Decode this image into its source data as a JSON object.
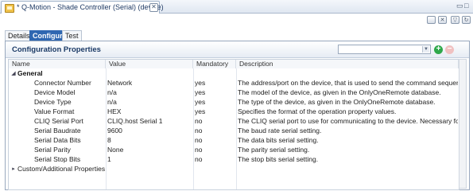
{
  "window": {
    "tab_title": "* Q-Motion - Shade Controller (Serial) (device)",
    "close_glyph": "✕",
    "minimize_glyph": "▭",
    "maximize_glyph": "□"
  },
  "toolbar": {
    "icons": [
      "save-icon",
      "delete-icon",
      "filter-icon",
      "refresh-icon"
    ]
  },
  "subtabs": [
    {
      "label": "Details",
      "active": false
    },
    {
      "label": "Configure",
      "active": true
    },
    {
      "label": "Test",
      "active": false
    }
  ],
  "panel": {
    "title": "Configuration Properties",
    "combo_value": "",
    "add_glyph": "+",
    "remove_glyph": "−"
  },
  "grid": {
    "columns": [
      "Name",
      "Value",
      "Mandatory",
      "Description"
    ],
    "groups": [
      {
        "name": "General",
        "expanded": true,
        "rows": [
          {
            "name": "Connector Number",
            "value": "Network",
            "mandatory": "yes",
            "description": "The address/port on the device, that is used to send the command sequence"
          },
          {
            "name": "Device Model",
            "value": "n/a",
            "mandatory": "yes",
            "description": "The model of the device, as given in the OnlyOneRemote database."
          },
          {
            "name": "Device Type",
            "value": "n/a",
            "mandatory": "yes",
            "description": "The type of the device, as given in the OnlyOneRemote database."
          },
          {
            "name": "Value Format",
            "value": "HEX",
            "mandatory": "yes",
            "description": "Specifies the format of the operation property values."
          },
          {
            "name": "CLIQ Serial Port",
            "value": "CLIQ.host Serial 1",
            "mandatory": "no",
            "description": "The CLIQ serial port to use for communicating to the device. Necessary for di"
          },
          {
            "name": "Serial Baudrate",
            "value": "9600",
            "mandatory": "no",
            "description": "The baud rate serial setting."
          },
          {
            "name": "Serial Data Bits",
            "value": "8",
            "mandatory": "no",
            "description": "The data bits serial setting."
          },
          {
            "name": "Serial Parity",
            "value": "None",
            "mandatory": "no",
            "description": "The parity serial setting."
          },
          {
            "name": "Serial Stop Bits",
            "value": "1",
            "mandatory": "no",
            "description": "The stop bits serial setting."
          }
        ]
      },
      {
        "name": "Custom/Additional Properties",
        "expanded": false,
        "rows": []
      }
    ]
  }
}
